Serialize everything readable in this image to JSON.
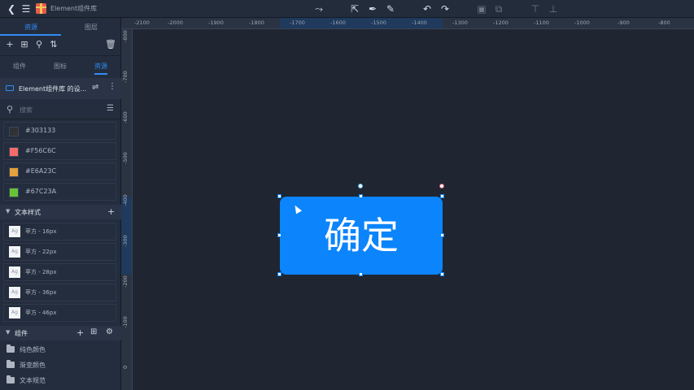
{
  "topbar": {
    "doc_title": "Element组件库"
  },
  "sidebar": {
    "tabs": [
      "资源",
      "图层"
    ],
    "subtabs": [
      "组件",
      "图标",
      "资源"
    ],
    "library": {
      "name": "Element组件库 的设..."
    },
    "search": {
      "placeholder": "搜索"
    },
    "colors": [
      {
        "hex": "#303133",
        "swatch": "#303133"
      },
      {
        "hex": "#F56C6C",
        "swatch": "#F56C6C"
      },
      {
        "hex": "#E6A23C",
        "swatch": "#E6A23C"
      },
      {
        "hex": "#67C23A",
        "swatch": "#67C23A"
      }
    ],
    "text_styles": {
      "title": "文本样式",
      "ag": "Ag",
      "items": [
        "苹方 - 16px",
        "苹方 - 22px",
        "苹方 - 28px",
        "苹方 - 36px",
        "苹方 - 46px"
      ]
    },
    "components": {
      "title": "组件",
      "folders": [
        "纯色颜色",
        "渐变颜色",
        "文本规范"
      ]
    }
  },
  "rulers": {
    "top": [
      "-2100",
      "-2000",
      "-1900",
      "-1800",
      "-1700",
      "-1600",
      "-1500",
      "-1400",
      "-1300",
      "-1200",
      "-1100",
      "-1000",
      "-900",
      "-800"
    ],
    "left": [
      "-800",
      "-700",
      "-600",
      "-500",
      "-400",
      "-300",
      "-200",
      "-100",
      "0"
    ]
  },
  "canvas": {
    "button_label": "确定",
    "button_color": "#0C84FB"
  },
  "colors": {
    "accent": "#2F8CF6",
    "bg": "#1F2632"
  }
}
